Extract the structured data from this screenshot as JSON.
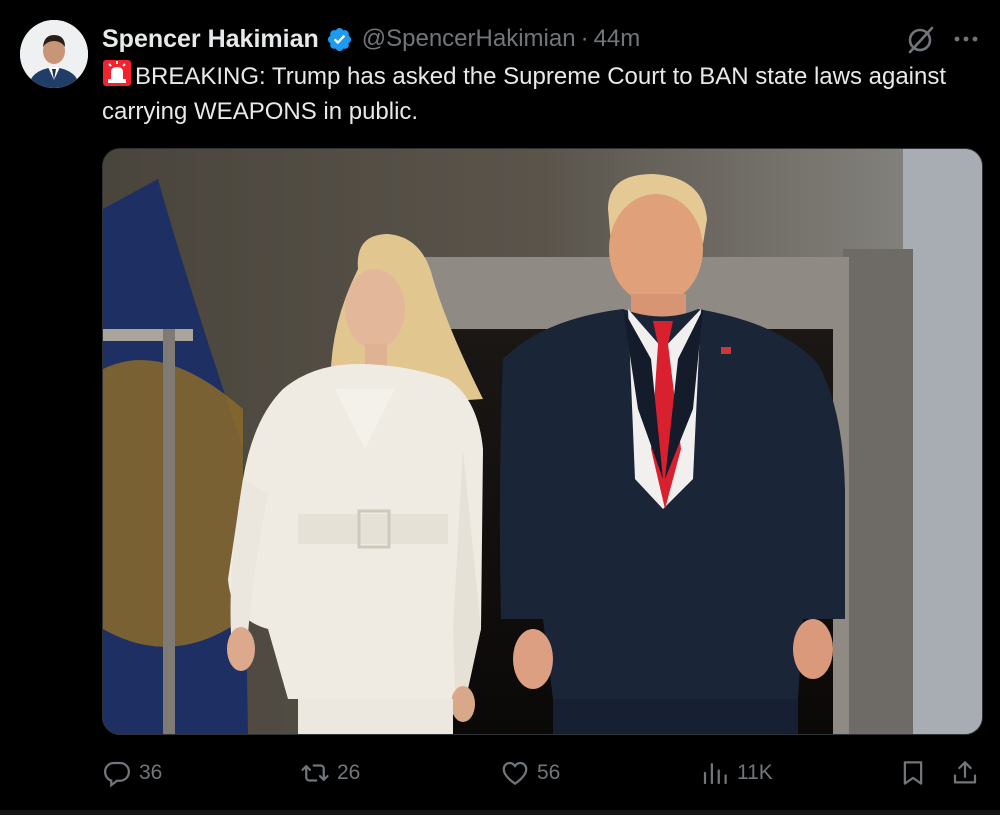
{
  "tweet": {
    "display_name": "Spencer Hakimian",
    "handle": "@SpencerHakimian",
    "separator": "·",
    "time": "44m",
    "text": "BREAKING: Trump has asked the Supreme Court to BAN state laws against carrying WEAPONS in public.",
    "emoji": "police-car-light-icon",
    "media_alt": "Photo of a woman in a white suit walking beside Donald Trump in a navy suit and red tie",
    "verified_color": "#1d9bf0"
  },
  "actions": {
    "replies": "36",
    "reposts": "26",
    "likes": "56",
    "views": "11K"
  },
  "colors": {
    "background": "#000000",
    "text": "#e7e9ea",
    "muted": "#71767b"
  }
}
